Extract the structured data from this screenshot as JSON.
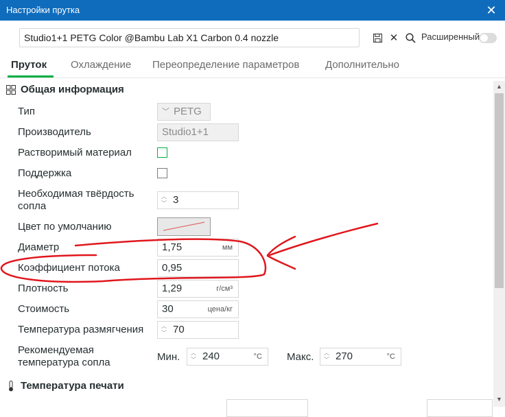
{
  "window": {
    "title": "Настройки прутка"
  },
  "preset": {
    "name": "Studio1+1 PETG Color @Bambu Lab X1 Carbon 0.4 nozzle"
  },
  "toolbar": {
    "advanced_label": "Расширенный"
  },
  "tabs": [
    {
      "label": "Пруток",
      "active": true
    },
    {
      "label": "Охлаждение"
    },
    {
      "label": "Переопределение параметров"
    },
    {
      "label": "Дополнительно"
    }
  ],
  "sections": {
    "general": {
      "title": "Общая информация"
    },
    "print_temp": {
      "title": "Температура печати"
    }
  },
  "fields": {
    "type": {
      "label": "Тип",
      "value": "PETG"
    },
    "vendor": {
      "label": "Производитель",
      "value": "Studio1+1"
    },
    "soluble": {
      "label": "Растворимый материал",
      "checked": false
    },
    "support": {
      "label": "Поддержка",
      "checked": false
    },
    "nozzle_hardness": {
      "label_line1": "Необходимая твёрдость",
      "label_line2": "сопла",
      "value": "3"
    },
    "default_color": {
      "label": "Цвет по умолчанию"
    },
    "diameter": {
      "label": "Диаметр",
      "value": "1,75",
      "unit": "мм"
    },
    "flow_ratio": {
      "label": "Коэффициент потока",
      "value": "0,95"
    },
    "density": {
      "label": "Плотность",
      "value": "1,29",
      "unit": "г/см³"
    },
    "cost": {
      "label": "Стоимость",
      "value": "30",
      "unit": "цена/кг"
    },
    "softening_temp": {
      "label": "Температура размягчения",
      "value": "70"
    },
    "nozzle_temp": {
      "label_line1": "Рекомендуемая",
      "label_line2": "температура сопла",
      "min_label": "Мин.",
      "min_value": "240",
      "min_unit": "°C",
      "max_label": "Макс.",
      "max_value": "270",
      "max_unit": "°C"
    }
  },
  "colors": {
    "titlebar": "#0f6cbd",
    "accent": "#00ae42",
    "annotation": "#e0161c"
  },
  "icons": {
    "save": "save-icon",
    "close": "close-icon",
    "search": "search-icon",
    "general": "grid-icon",
    "temperature": "thermometer-icon"
  }
}
